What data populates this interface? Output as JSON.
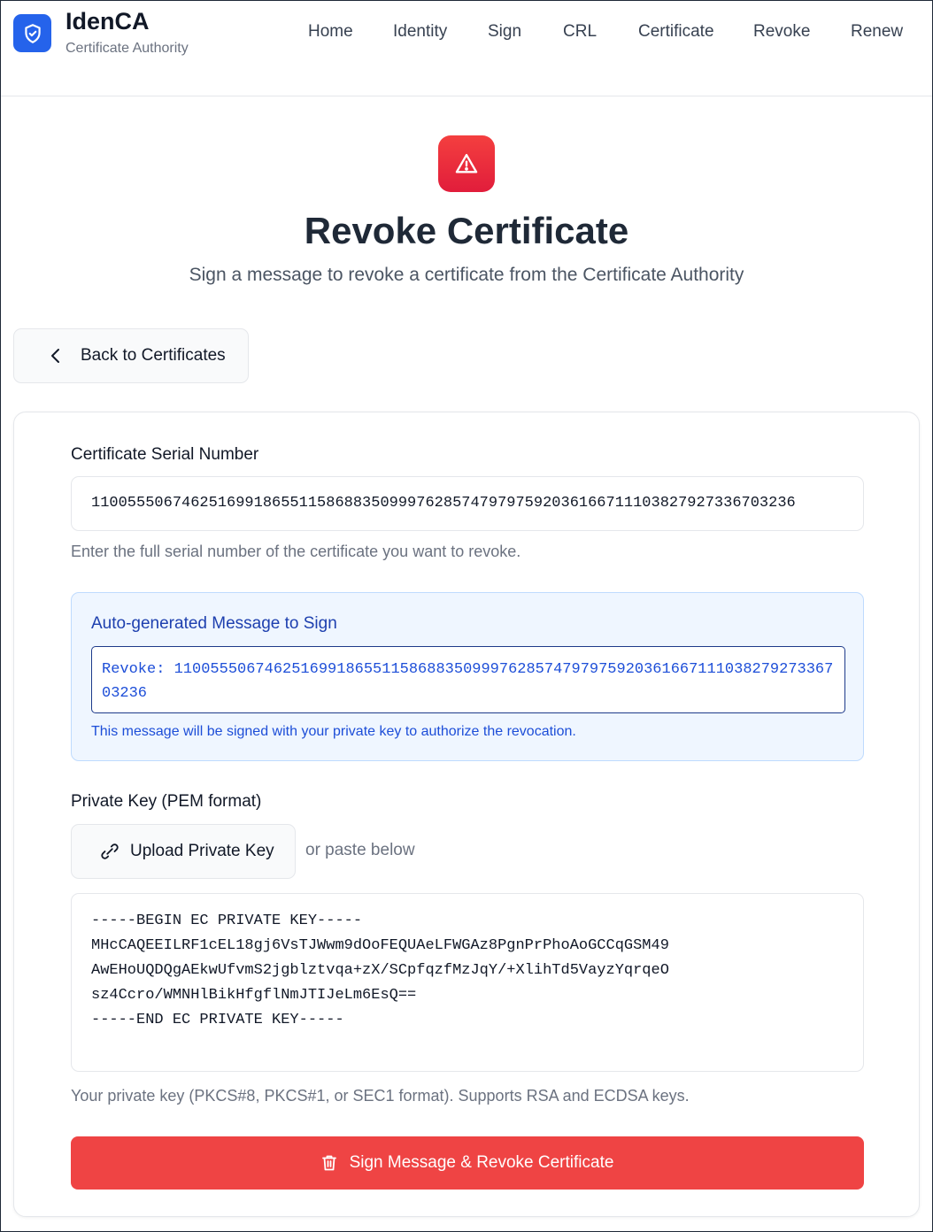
{
  "brand": {
    "name": "IdenCA",
    "subtitle": "Certificate Authority"
  },
  "nav": {
    "items": [
      "Home",
      "Identity",
      "Sign",
      "CRL",
      "Certificate",
      "Revoke",
      "Renew"
    ]
  },
  "hero": {
    "title": "Revoke Certificate",
    "subtitle": "Sign a message to revoke a certificate from the Certificate Authority"
  },
  "back_button": {
    "label": "Back to Certificates"
  },
  "form": {
    "serial_label": "Certificate Serial Number",
    "serial_value": "110055506746251699186551158688350999762857479797592036166711103827927336703236",
    "serial_hint": "Enter the full serial number of the certificate you want to revoke.",
    "message_title": "Auto-generated Message to Sign",
    "message_value": "Revoke: 110055506746251699186551158688350999762857479797592036166711103827927336703236",
    "message_note": "This message will be signed with your private key to authorize the revocation.",
    "key_label": "Private Key (PEM format)",
    "upload_label": "Upload Private Key",
    "or_text": "or paste below",
    "key_value": "-----BEGIN EC PRIVATE KEY-----\nMHcCAQEEILRF1cEL18gj6VsTJWwm9dOoFEQUAeLFWGAz8PgnPrPhoAoGCCqGSM49\nAwEHoUQDQgAEkwUfvmS2jgblztvqa+zX/SCpfqzfMzJqY/+XlihTd5VayzYqrqeO\nsz4Ccro/WMNHlBikHfgflNmJTIJeLm6EsQ==\n-----END EC PRIVATE KEY-----",
    "key_hint": "Your private key (PKCS#8, PKCS#1, or SEC1 format). Supports RSA and ECDSA keys.",
    "submit_label": "Sign Message & Revoke Certificate"
  },
  "colors": {
    "primary": "#2563eb",
    "danger": "#ef4444",
    "info_bg": "#eff6ff",
    "info_text": "#1d4ed8"
  },
  "icons": {
    "logo": "shield-check-icon",
    "hero": "warning-triangle-icon",
    "back": "chevron-left-icon",
    "upload": "link-icon",
    "submit": "trash-icon"
  }
}
